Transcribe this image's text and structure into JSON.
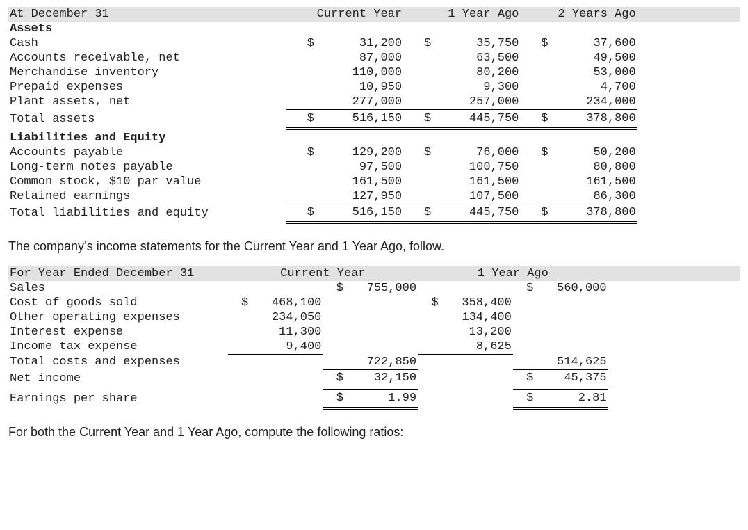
{
  "balance_sheet": {
    "header_label": "At December 31",
    "col1": "Current Year",
    "col2": "1 Year Ago",
    "col3": "2 Years Ago",
    "assets_label": "Assets",
    "rows_assets": [
      {
        "label": "Cash",
        "s1": "$",
        "v1": "31,200",
        "s2": "$",
        "v2": "35,750",
        "s3": "$",
        "v3": "37,600"
      },
      {
        "label": "Accounts receivable, net",
        "s1": "",
        "v1": "87,000",
        "s2": "",
        "v2": "63,500",
        "s3": "",
        "v3": "49,500"
      },
      {
        "label": "Merchandise inventory",
        "s1": "",
        "v1": "110,000",
        "s2": "",
        "v2": "80,200",
        "s3": "",
        "v3": "53,000"
      },
      {
        "label": "Prepaid expenses",
        "s1": "",
        "v1": "10,950",
        "s2": "",
        "v2": "9,300",
        "s3": "",
        "v3": "4,700"
      },
      {
        "label": "Plant assets, net",
        "s1": "",
        "v1": "277,000",
        "s2": "",
        "v2": "257,000",
        "s3": "",
        "v3": "234,000"
      }
    ],
    "total_assets": {
      "label": "Total assets",
      "s1": "$",
      "v1": "516,150",
      "s2": "$",
      "v2": "445,750",
      "s3": "$",
      "v3": "378,800"
    },
    "liab_label": "Liabilities and Equity",
    "rows_liab": [
      {
        "label": "Accounts payable",
        "s1": "$",
        "v1": "129,200",
        "s2": "$",
        "v2": "76,000",
        "s3": "$",
        "v3": "50,200"
      },
      {
        "label": "Long-term notes payable",
        "s1": "",
        "v1": "97,500",
        "s2": "",
        "v2": "100,750",
        "s3": "",
        "v3": "80,800"
      },
      {
        "label": "Common stock, $10 par value",
        "s1": "",
        "v1": "161,500",
        "s2": "",
        "v2": "161,500",
        "s3": "",
        "v3": "161,500"
      },
      {
        "label": "Retained earnings",
        "s1": "",
        "v1": "127,950",
        "s2": "",
        "v2": "107,500",
        "s3": "",
        "v3": "86,300"
      }
    ],
    "total_liab": {
      "label": "Total liabilities and equity",
      "s1": "$",
      "v1": "516,150",
      "s2": "$",
      "v2": "445,750",
      "s3": "$",
      "v3": "378,800"
    }
  },
  "narr1": "The company’s income statements for the Current Year and 1 Year Ago, follow.",
  "income_statement": {
    "header_label": "For Year Ended December 31",
    "col1": "Current Year",
    "col2": "1 Year Ago",
    "sales": {
      "label": "Sales",
      "s1": "$",
      "v1": "755,000",
      "s2": "$",
      "v2": "560,000"
    },
    "detail": [
      {
        "label": "Cost of goods sold",
        "s1": "$",
        "v1": "468,100",
        "s2": "$",
        "v2": "358,400"
      },
      {
        "label": "Other operating expenses",
        "s1": "",
        "v1": "234,050",
        "s2": "",
        "v2": "134,400"
      },
      {
        "label": "Interest expense",
        "s1": "",
        "v1": "11,300",
        "s2": "",
        "v2": "13,200"
      },
      {
        "label": "Income tax expense",
        "s1": "",
        "v1": "9,400",
        "s2": "",
        "v2": "8,625"
      }
    ],
    "totals": {
      "label": "Total costs and expenses",
      "v1": "722,850",
      "v2": "514,625"
    },
    "net": {
      "label": "Net income",
      "s1": "$",
      "v1": "32,150",
      "s2": "$",
      "v2": "45,375"
    },
    "eps": {
      "label": "Earnings per share",
      "s1": "$",
      "v1": "1.99",
      "s2": "$",
      "v2": "2.81"
    }
  },
  "narr2": "For both the Current Year and 1 Year Ago, compute the following ratios:"
}
